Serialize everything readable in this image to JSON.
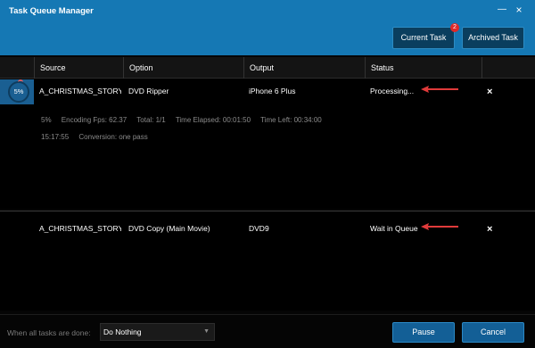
{
  "window": {
    "title": "Task Queue Manager",
    "minimize_glyph": "—",
    "close_glyph": "×"
  },
  "tabs": {
    "current_task": "Current Task",
    "current_task_badge": "2",
    "archived_task": "Archived Task"
  },
  "table": {
    "headers": [
      "Source",
      "Option",
      "Output",
      "Status"
    ]
  },
  "tasks": [
    {
      "progress_label": "5%",
      "source": "A_CHRISTMAS_STORY",
      "option": "DVD Ripper",
      "output": "iPhone 6 Plus",
      "status": "Processing...",
      "remove_glyph": "×",
      "details_line1": [
        "5%",
        "Encoding Fps: 62.37",
        "Total: 1/1",
        "Time Elapsed: 00:01:50",
        "Time Left: 00:34:00"
      ],
      "details_line2": [
        "15:17:55",
        "Conversion: one pass"
      ]
    },
    {
      "source": "A_CHRISTMAS_STORY",
      "option": "DVD Copy (Main Movie)",
      "output": "DVD9",
      "status": "Wait in Queue",
      "remove_glyph": "×"
    }
  ],
  "footer": {
    "when_done_label": "When all tasks are done:",
    "when_done_value": "Do Nothing",
    "pause": "Pause",
    "cancel": "Cancel"
  },
  "colors": {
    "titlebar": "#1578b4",
    "button": "#135f96",
    "badge": "#e02828",
    "annotation_arrow": "#e03a3a"
  }
}
